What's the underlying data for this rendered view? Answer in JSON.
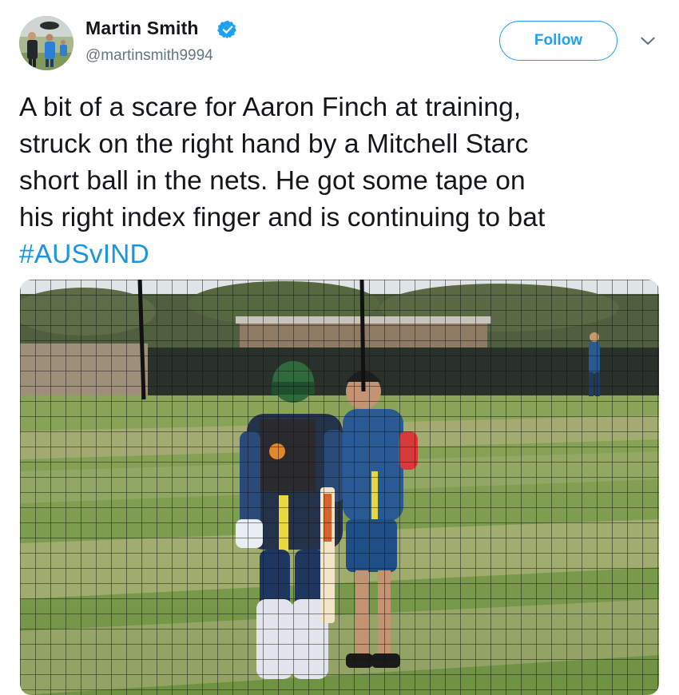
{
  "user": {
    "name": "Martin Smith",
    "handle": "@martinsmith9994",
    "verified": true
  },
  "follow_button": {
    "label": "Follow"
  },
  "menu": {
    "icon": "chevron-down-icon"
  },
  "tweet": {
    "lines": [
      "A bit of a scare for Aaron Finch at training,",
      "struck on the right hand by a Mitchell Starc",
      "short ball in the nets. He got some tape on",
      "his right index finger and is continuing to bat"
    ],
    "hashtag": "#AUSvIND"
  },
  "colors": {
    "accent": "#1da1f2",
    "hashtag": "#1b95e0",
    "text": "#14171a",
    "secondary": "#657786"
  }
}
